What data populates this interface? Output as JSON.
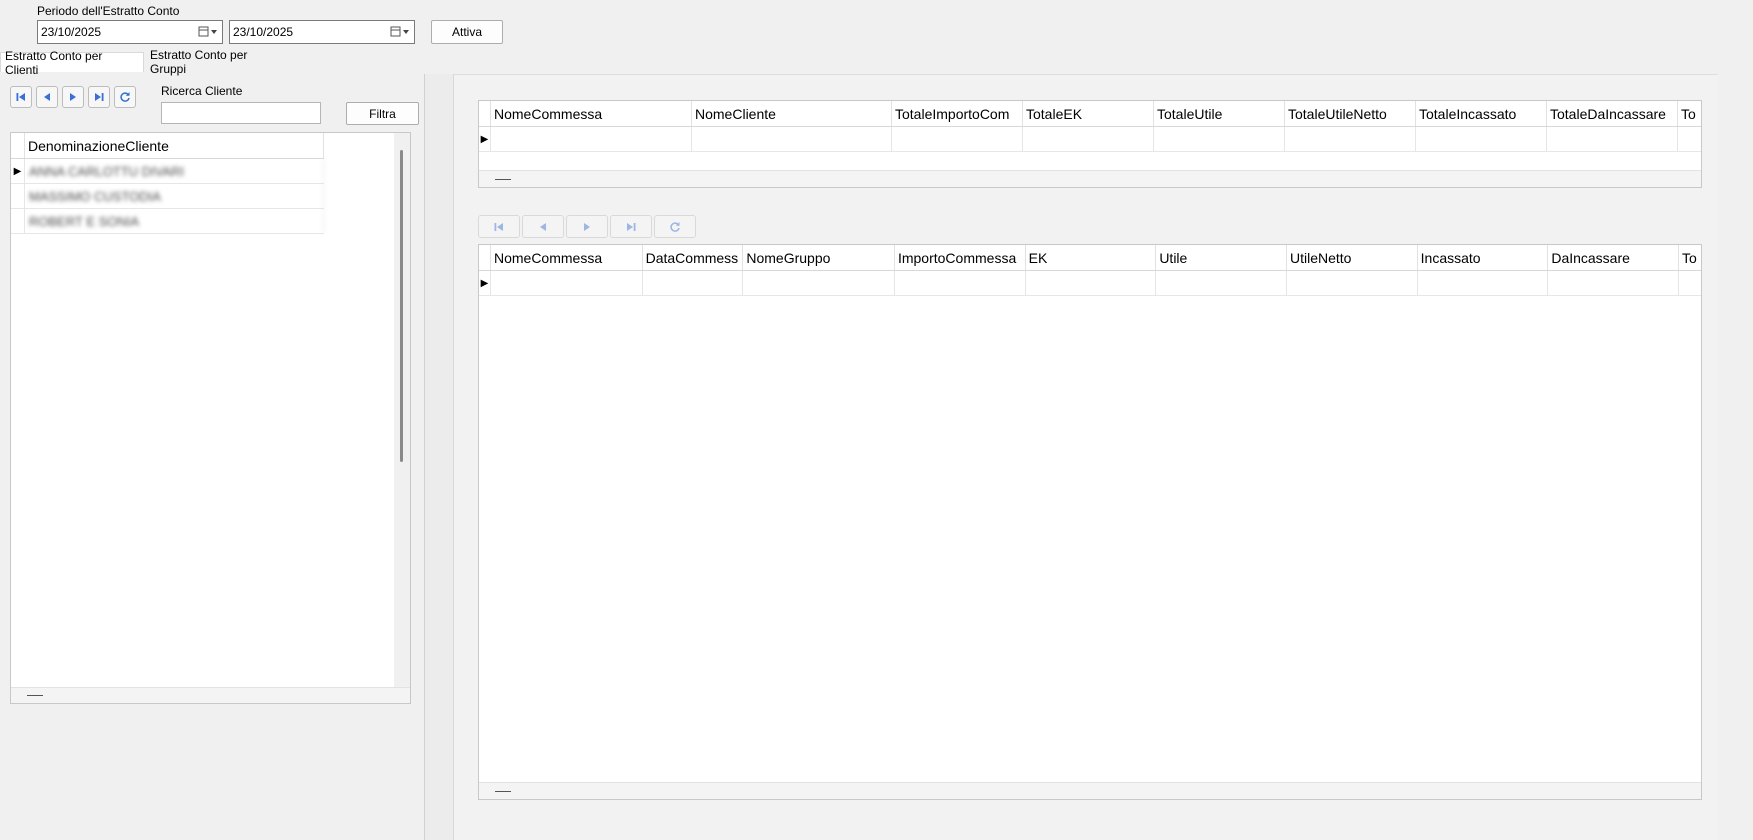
{
  "period": {
    "label": "Periodo dell'Estratto Conto",
    "date_from": "23/10/2025",
    "date_to": "23/10/2025",
    "activate_label": "Attiva"
  },
  "tabs": [
    {
      "label": "Estratto Conto per Clienti",
      "active": true
    },
    {
      "label": "Estratto Conto per Gruppi",
      "active": false
    }
  ],
  "clients": {
    "search_label": "Ricerca Cliente",
    "search_value": "",
    "filter_label": "Filtra",
    "header": "DenominazioneCliente",
    "rows": [
      "ANNA CARLOTTU DIVARI",
      "MASSIMO CUSTODIA",
      "ROBERT E SONIA"
    ]
  },
  "summary_grid": {
    "columns": [
      "NomeCommessa",
      "NomeCliente",
      "TotaleImportoCom",
      "TotaleEK",
      "TotaleUtile",
      "TotaleUtileNetto",
      "TotaleIncassato",
      "TotaleDaIncassare",
      "To"
    ]
  },
  "detail_grid": {
    "columns": [
      "NomeCommessa",
      "DataCommess",
      "NomeGruppo",
      "ImportoCommessa",
      "EK",
      "Utile",
      "UtileNetto",
      "Incassato",
      "DaIncassare",
      "To"
    ]
  },
  "colors": {
    "nav_icon": "#3a6fd8",
    "nav_icon_disabled": "#9fb6de",
    "refresh_icon": "#2f6fd0"
  }
}
